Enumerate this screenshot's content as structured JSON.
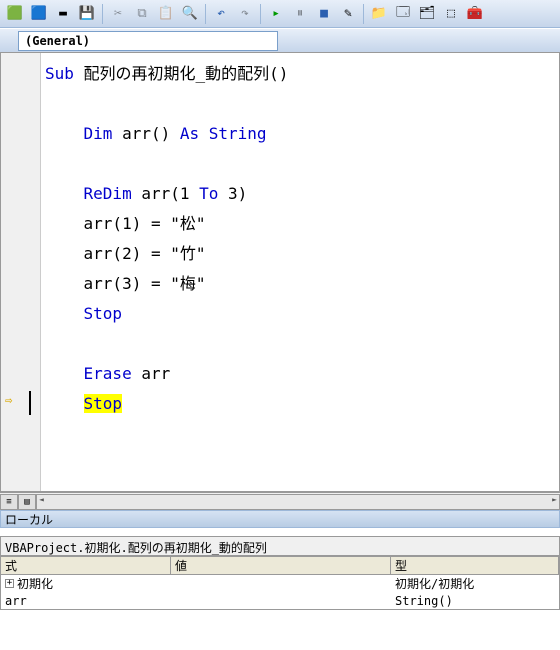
{
  "toolbar": {
    "icons": [
      "excel-icon",
      "word-icon",
      "line-icon",
      "save-icon",
      "cut-icon",
      "copy-icon",
      "paste-icon",
      "find-icon",
      "undo-icon",
      "redo-icon",
      "run-icon",
      "break-icon",
      "reset-icon",
      "design-icon",
      "project-icon",
      "props-icon",
      "obj-icon",
      "order-icon"
    ]
  },
  "dropdown": {
    "value": "(General)"
  },
  "code": {
    "lines": [
      {
        "t": "Sub ",
        "k": "配列の再初期化_動的配列()",
        "type": "sub"
      },
      {
        "t": ""
      },
      {
        "t": "    ",
        "seg": [
          [
            "Dim ",
            "kw"
          ],
          [
            "arr() ",
            "n"
          ],
          [
            "As String",
            "kw"
          ]
        ]
      },
      {
        "t": ""
      },
      {
        "t": "    ",
        "seg": [
          [
            "ReDim ",
            "kw"
          ],
          [
            "arr(1 ",
            "n"
          ],
          [
            "To ",
            "kw"
          ],
          [
            "3)",
            "n"
          ]
        ]
      },
      {
        "t": "    arr(1) = \"松\""
      },
      {
        "t": "    arr(2) = \"竹\""
      },
      {
        "t": "    arr(3) = \"梅\""
      },
      {
        "t": "    ",
        "seg": [
          [
            "Stop",
            "kw"
          ]
        ]
      },
      {
        "t": ""
      },
      {
        "t": "    ",
        "seg": [
          [
            "Erase ",
            "kw"
          ],
          [
            "arr",
            "n"
          ]
        ]
      },
      {
        "t": "    ",
        "seg": [
          [
            "Stop",
            "hl"
          ]
        ],
        "current": true
      },
      {
        "t": ""
      }
    ]
  },
  "locals": {
    "title": "ローカル",
    "context": "VBAProject.初期化.配列の再初期化_動的配列",
    "headers": {
      "expr": "式",
      "val": "値",
      "type": "型"
    },
    "rows": [
      {
        "exp": "+",
        "name": "初期化",
        "val": "",
        "type": "初期化/初期化"
      },
      {
        "exp": "",
        "name": "  arr",
        "val": "",
        "type": "String()"
      }
    ]
  }
}
